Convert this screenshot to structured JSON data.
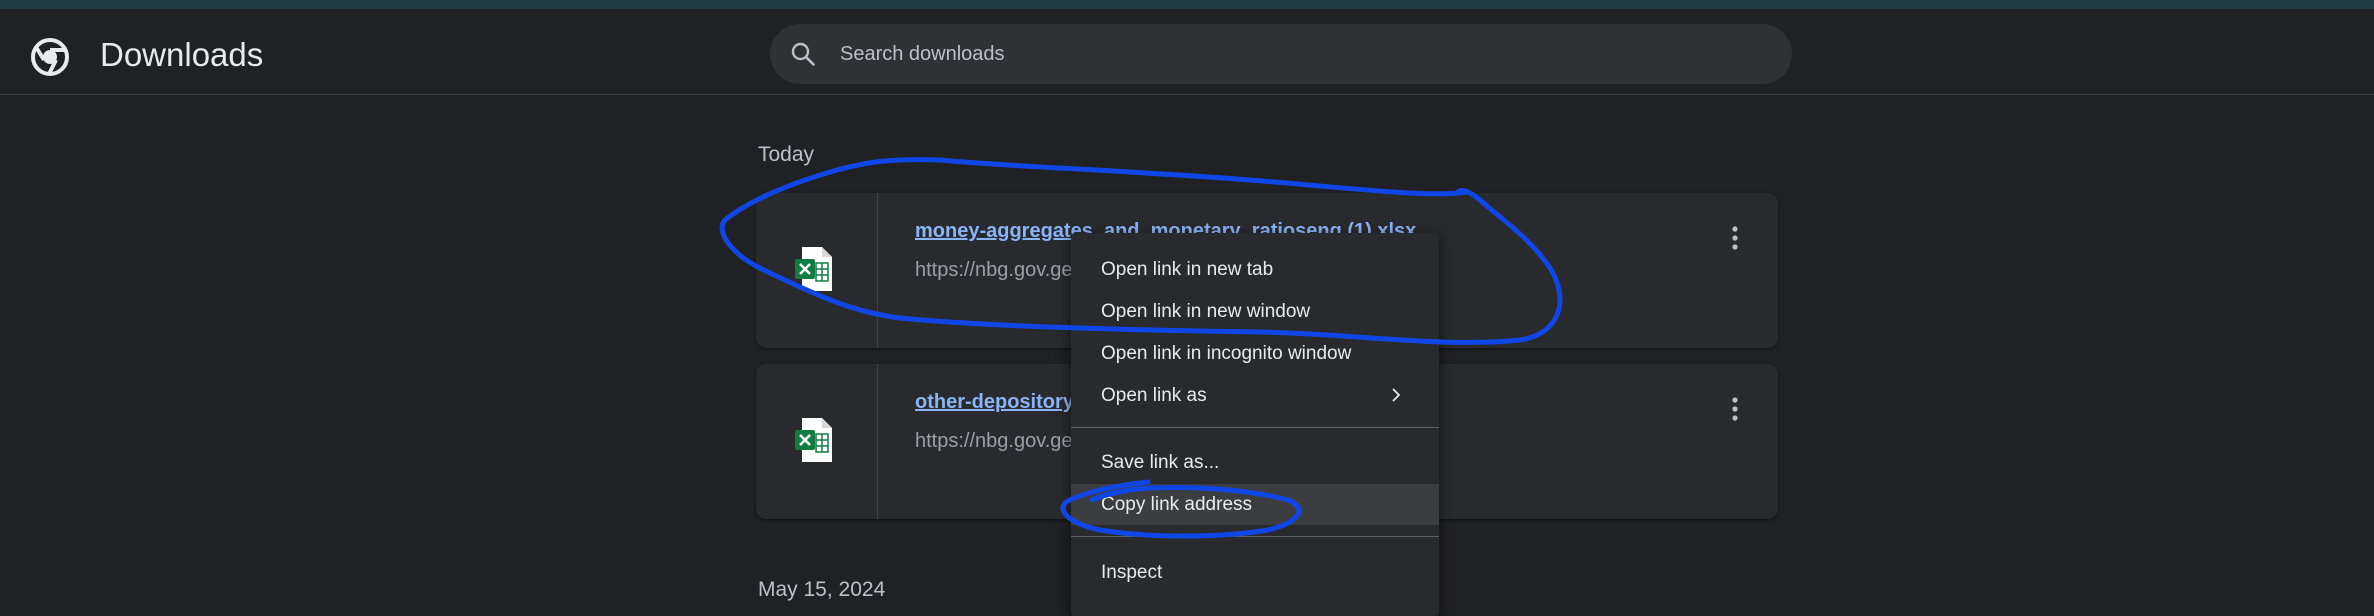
{
  "header": {
    "title": "Downloads",
    "logo_icon": "chrome-logo-icon",
    "search": {
      "placeholder": "Search downloads",
      "value": "",
      "icon": "search-icon"
    }
  },
  "sections": [
    {
      "label": "Today",
      "items": [
        {
          "file_name": "money-aggregates_and_monetary_ratioseng (1).xlsx",
          "url": "https://nbg.gov.ge",
          "icon": "excel-file-icon"
        },
        {
          "file_name": "other-depository-",
          "url": "https://nbg.gov.ge",
          "icon": "excel-file-icon"
        }
      ]
    },
    {
      "label": "May 15, 2024",
      "items": []
    }
  ],
  "context_menu": {
    "items": [
      {
        "label": "Open link in new tab"
      },
      {
        "label": "Open link in new window"
      },
      {
        "label": "Open link in incognito window"
      },
      {
        "label": "Open link as",
        "submenu_icon": "chevron-right-icon"
      },
      {
        "label": "Save link as..."
      },
      {
        "label": "Copy link address",
        "highlighted": true
      },
      {
        "label": "Inspect"
      }
    ]
  },
  "colors": {
    "background": "#202124",
    "card": "#292a2d",
    "link": "#8ab4f8",
    "annotation": "#1046e6"
  }
}
